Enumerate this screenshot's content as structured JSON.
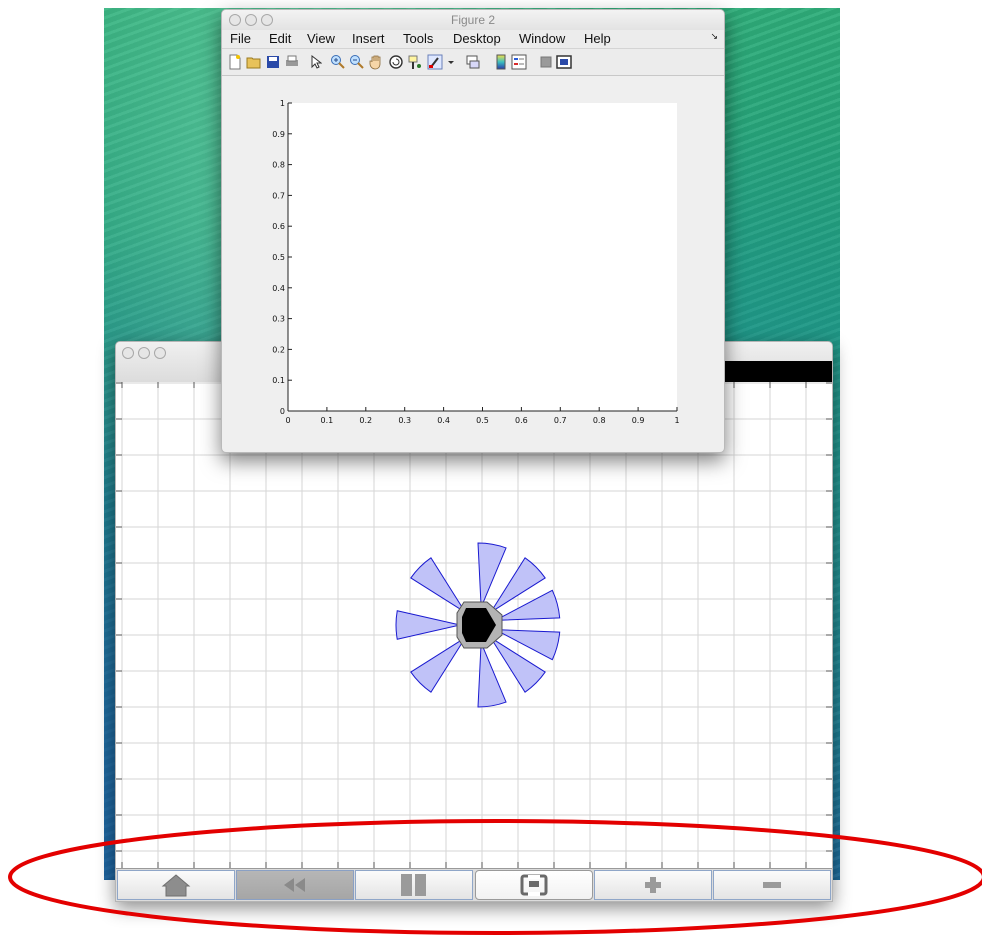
{
  "figure_window": {
    "title": "Figure 2",
    "menu": [
      "File",
      "Edit",
      "View",
      "Insert",
      "Tools",
      "Desktop",
      "Window",
      "Help"
    ],
    "toolbar_icons": [
      "new-figure-icon",
      "open-file-icon",
      "save-icon",
      "print-icon",
      "select-arrow-icon",
      "zoom-in-icon",
      "zoom-out-icon",
      "pan-hand-icon",
      "rotate-3d-icon",
      "data-cursor-icon",
      "brush-icon",
      "link-plot-icon",
      "colorbar-icon",
      "legend-icon",
      "hide-plot-tools-icon",
      "show-plot-tools-icon"
    ],
    "axes": {
      "xticks": [
        "0",
        "0.1",
        "0.2",
        "0.3",
        "0.4",
        "0.5",
        "0.6",
        "0.7",
        "0.8",
        "0.9",
        "1"
      ],
      "yticks": [
        "0",
        "0.1",
        "0.2",
        "0.3",
        "0.4",
        "0.5",
        "0.6",
        "0.7",
        "0.8",
        "0.9",
        "1"
      ],
      "xlim": [
        0,
        1
      ],
      "ylim": [
        0,
        1
      ]
    }
  },
  "simulator_window": {
    "robot": {
      "body_color": "#000000",
      "shell_color": "#b4b4b4",
      "sensor_fill": "#c0c2f8",
      "sensor_stroke": "#1a1ad0",
      "sensor_count": 9,
      "sensor_headings_deg": [
        -135,
        -80,
        -45,
        -15,
        15,
        45,
        80,
        135,
        180
      ]
    },
    "toolbar": {
      "buttons": [
        {
          "name": "home-button",
          "icon": "home-icon",
          "state": "normal"
        },
        {
          "name": "rewind-button",
          "icon": "rewind-icon",
          "state": "pressed"
        },
        {
          "name": "pause-button",
          "icon": "pause-icon",
          "state": "normal"
        },
        {
          "name": "follow-robot-button",
          "icon": "follow-icon",
          "state": "selected"
        },
        {
          "name": "zoom-in-button",
          "icon": "plus-icon",
          "state": "normal"
        },
        {
          "name": "zoom-out-button",
          "icon": "minus-icon",
          "state": "normal"
        }
      ]
    }
  },
  "annotation": {
    "shape": "ellipse",
    "color": "#e30000",
    "target": "simulator toolbar"
  }
}
